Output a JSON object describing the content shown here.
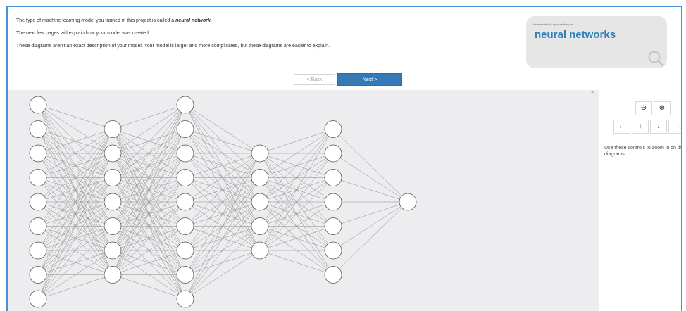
{
  "intro": {
    "line1_prefix": "The type of machine learning model you trained in this project is called a",
    "line1_term": "neural network",
    "line1_suffix": ".",
    "line2": "The next few pages will explain how your model was created.",
    "line3": "These diagrams aren't an exact description of your model. Your model is larger and more complicated, but these diagrams are easier to explain."
  },
  "search": {
    "hint": "for more detail, try searching for:",
    "term": "neural networks",
    "icon": "magnifier-icon"
  },
  "nav": {
    "back_label": "< Back",
    "next_label": "Next >"
  },
  "network": {
    "layer_sizes": [
      9,
      7,
      9,
      5,
      7,
      1
    ],
    "node_fill": "#ffffff",
    "node_stroke": "#555555",
    "edge_color": "#8a8a8a",
    "background": "#ededf0"
  },
  "controls": {
    "zoom_out_icon": "zoom-out-icon",
    "zoom_in_icon": "zoom-in-icon",
    "zoom_out_glyph": "⊖",
    "zoom_in_glyph": "⊕",
    "left_glyph": "←",
    "up_glyph": "↑",
    "down_glyph": "↓",
    "right_glyph": "→",
    "hint": "Use these controls to zoom in on the diagrams"
  },
  "scrollbar": {
    "up_glyph": "▲"
  }
}
